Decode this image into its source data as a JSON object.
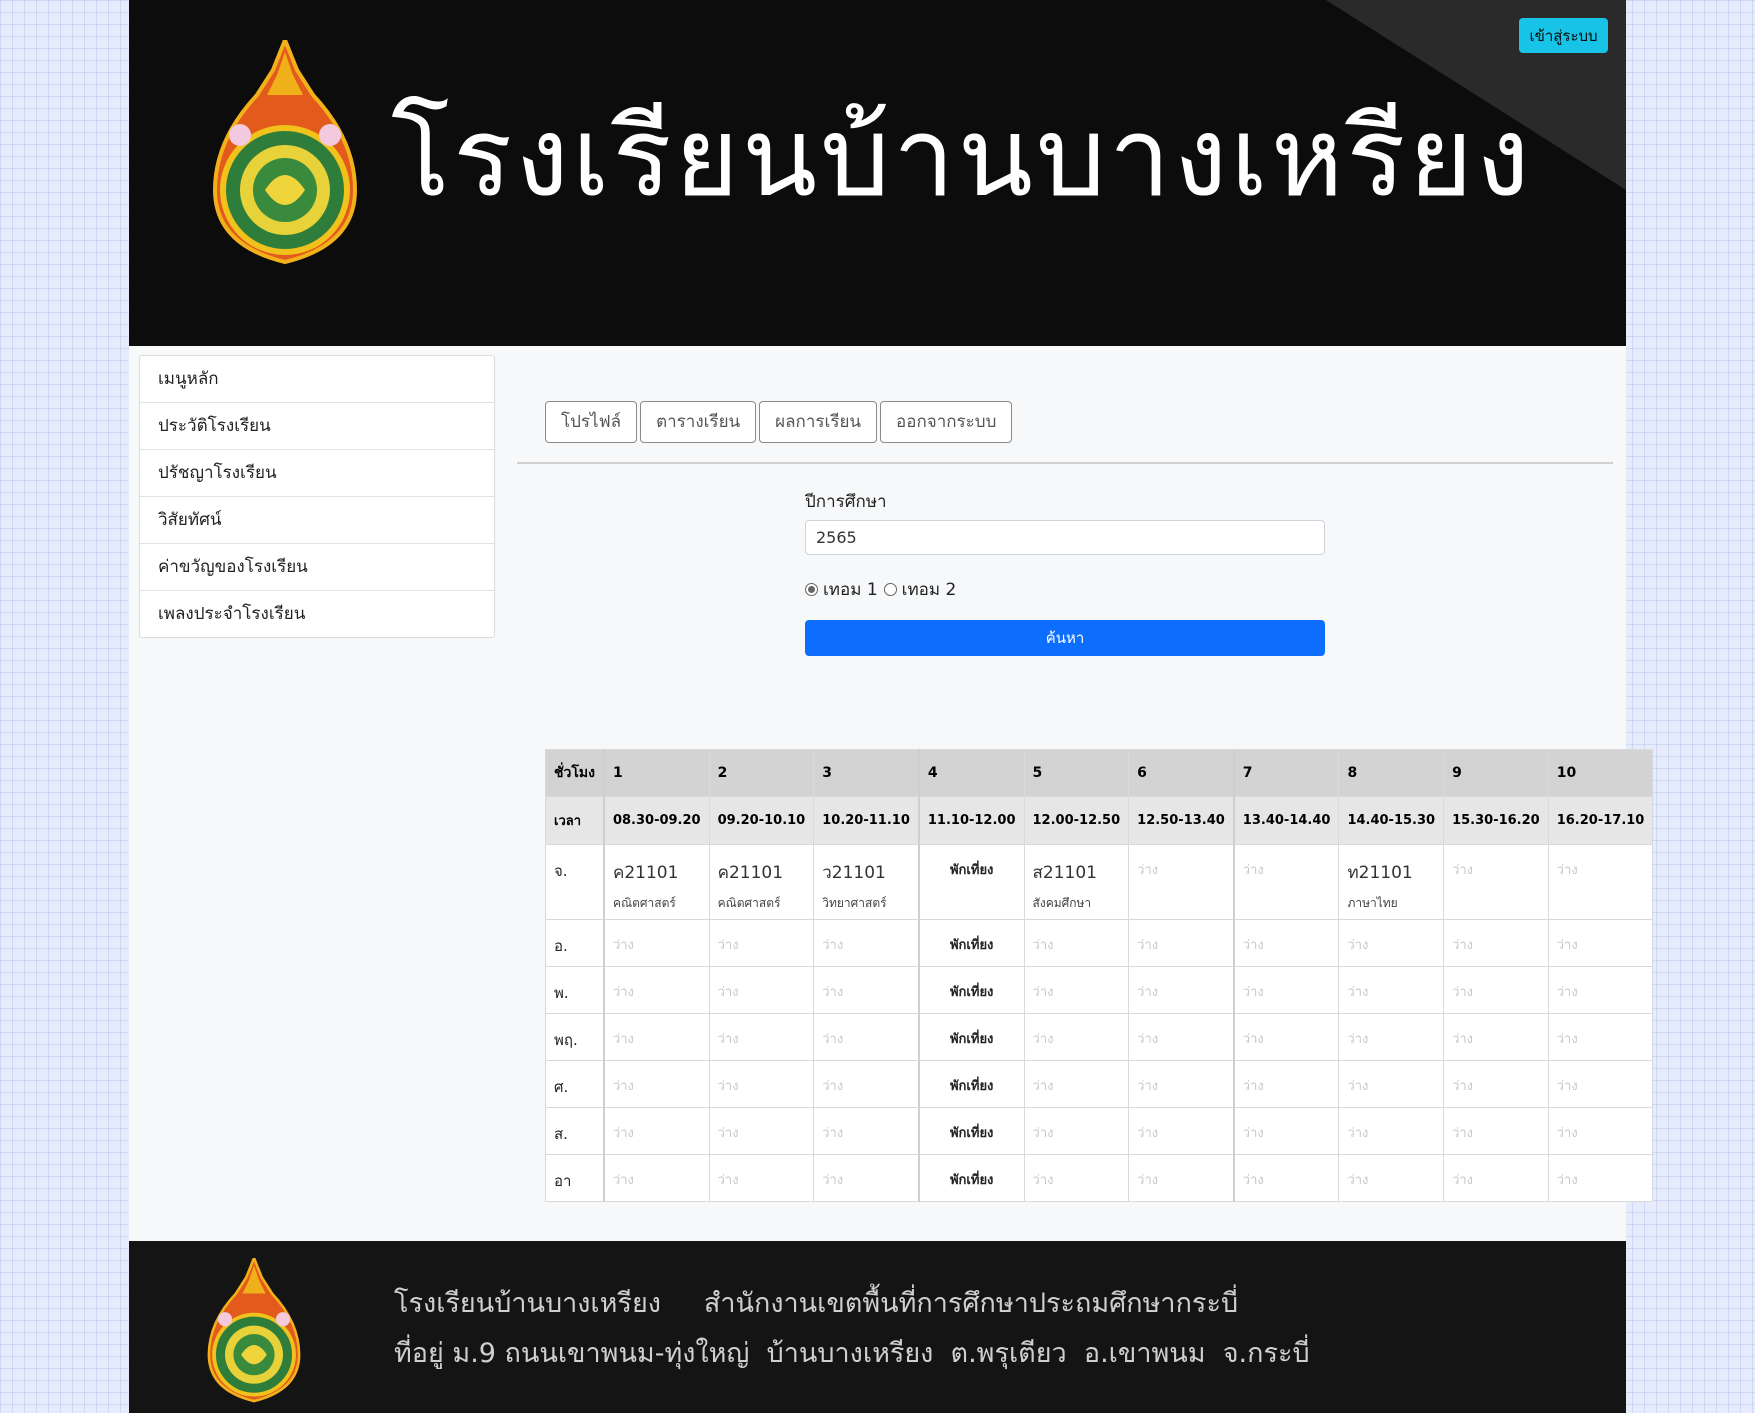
{
  "header": {
    "school_name": "โรงเรียนบ้านบางเหรียง",
    "login_label": "เข้าสู่ระบบ"
  },
  "sidebar": {
    "items": [
      {
        "label": "เมนูหลัก"
      },
      {
        "label": "ประวัติโรงเรียน"
      },
      {
        "label": "ปรัชญาโรงเรียน"
      },
      {
        "label": "วิสัยทัศน์"
      },
      {
        "label": "ค่าขวัญของโรงเรียน"
      },
      {
        "label": "เพลงประจำโรงเรียน"
      }
    ]
  },
  "tabs": [
    {
      "label": "โปรไฟล์"
    },
    {
      "label": "ตารางเรียน"
    },
    {
      "label": "ผลการเรียน"
    },
    {
      "label": "ออกจากระบบ"
    }
  ],
  "form": {
    "year_label": "ปีการศึกษา",
    "year_value": "2565",
    "term1_label": "เทอม 1",
    "term2_label": "เทอม 2",
    "selected_term": 1,
    "search_label": "ค้นหา"
  },
  "timetable": {
    "period_header": "ชั่วโมง",
    "time_header": "เวลา",
    "periods": [
      "1",
      "2",
      "3",
      "4",
      "5",
      "6",
      "7",
      "8",
      "9",
      "10"
    ],
    "times": [
      "08.30-09.20",
      "09.20-10.10",
      "10.20-11.10",
      "11.10-12.00",
      "12.00-12.50",
      "12.50-13.40",
      "13.40-14.40",
      "14.40-15.30",
      "15.30-16.20",
      "16.20-17.10"
    ],
    "lunch_label": "พักเที่ยง",
    "empty_label": "ว่าง",
    "monday": {
      "day": "จ.",
      "cells": [
        {
          "code": "ค21101",
          "subject": "คณิตศาสตร์"
        },
        {
          "code": "ค21101",
          "subject": "คณิตศาสตร์"
        },
        {
          "code": "ว21101",
          "subject": "วิทยาศาสตร์"
        },
        {
          "lunch": "พักเที่ยง"
        },
        {
          "code": "ส21101",
          "subject": "สังคมศึกษา"
        },
        {
          "empty": "ว่าง"
        },
        {
          "empty": "ว่าง"
        },
        {
          "code": "ท21101",
          "subject": "ภาษาไทย"
        },
        {
          "empty": "ว่าง"
        },
        {
          "empty": "ว่าง"
        }
      ]
    },
    "other_days": [
      "อ.",
      "พ.",
      "พฤ.",
      "ศ.",
      "ส.",
      "อา"
    ]
  },
  "footer": {
    "line1": "โรงเรียนบ้านบางเหรียง     สำนักงานเขตพื้นที่การศึกษาประถมศึกษากระบี่",
    "line2": "ที่อยู่ ม.9 ถนนเขาพนม-ทุ่งใหญ่  บ้านบางเหรียง  ต.พรุเตียว  อ.เขาพนม  จ.กระบี่"
  }
}
